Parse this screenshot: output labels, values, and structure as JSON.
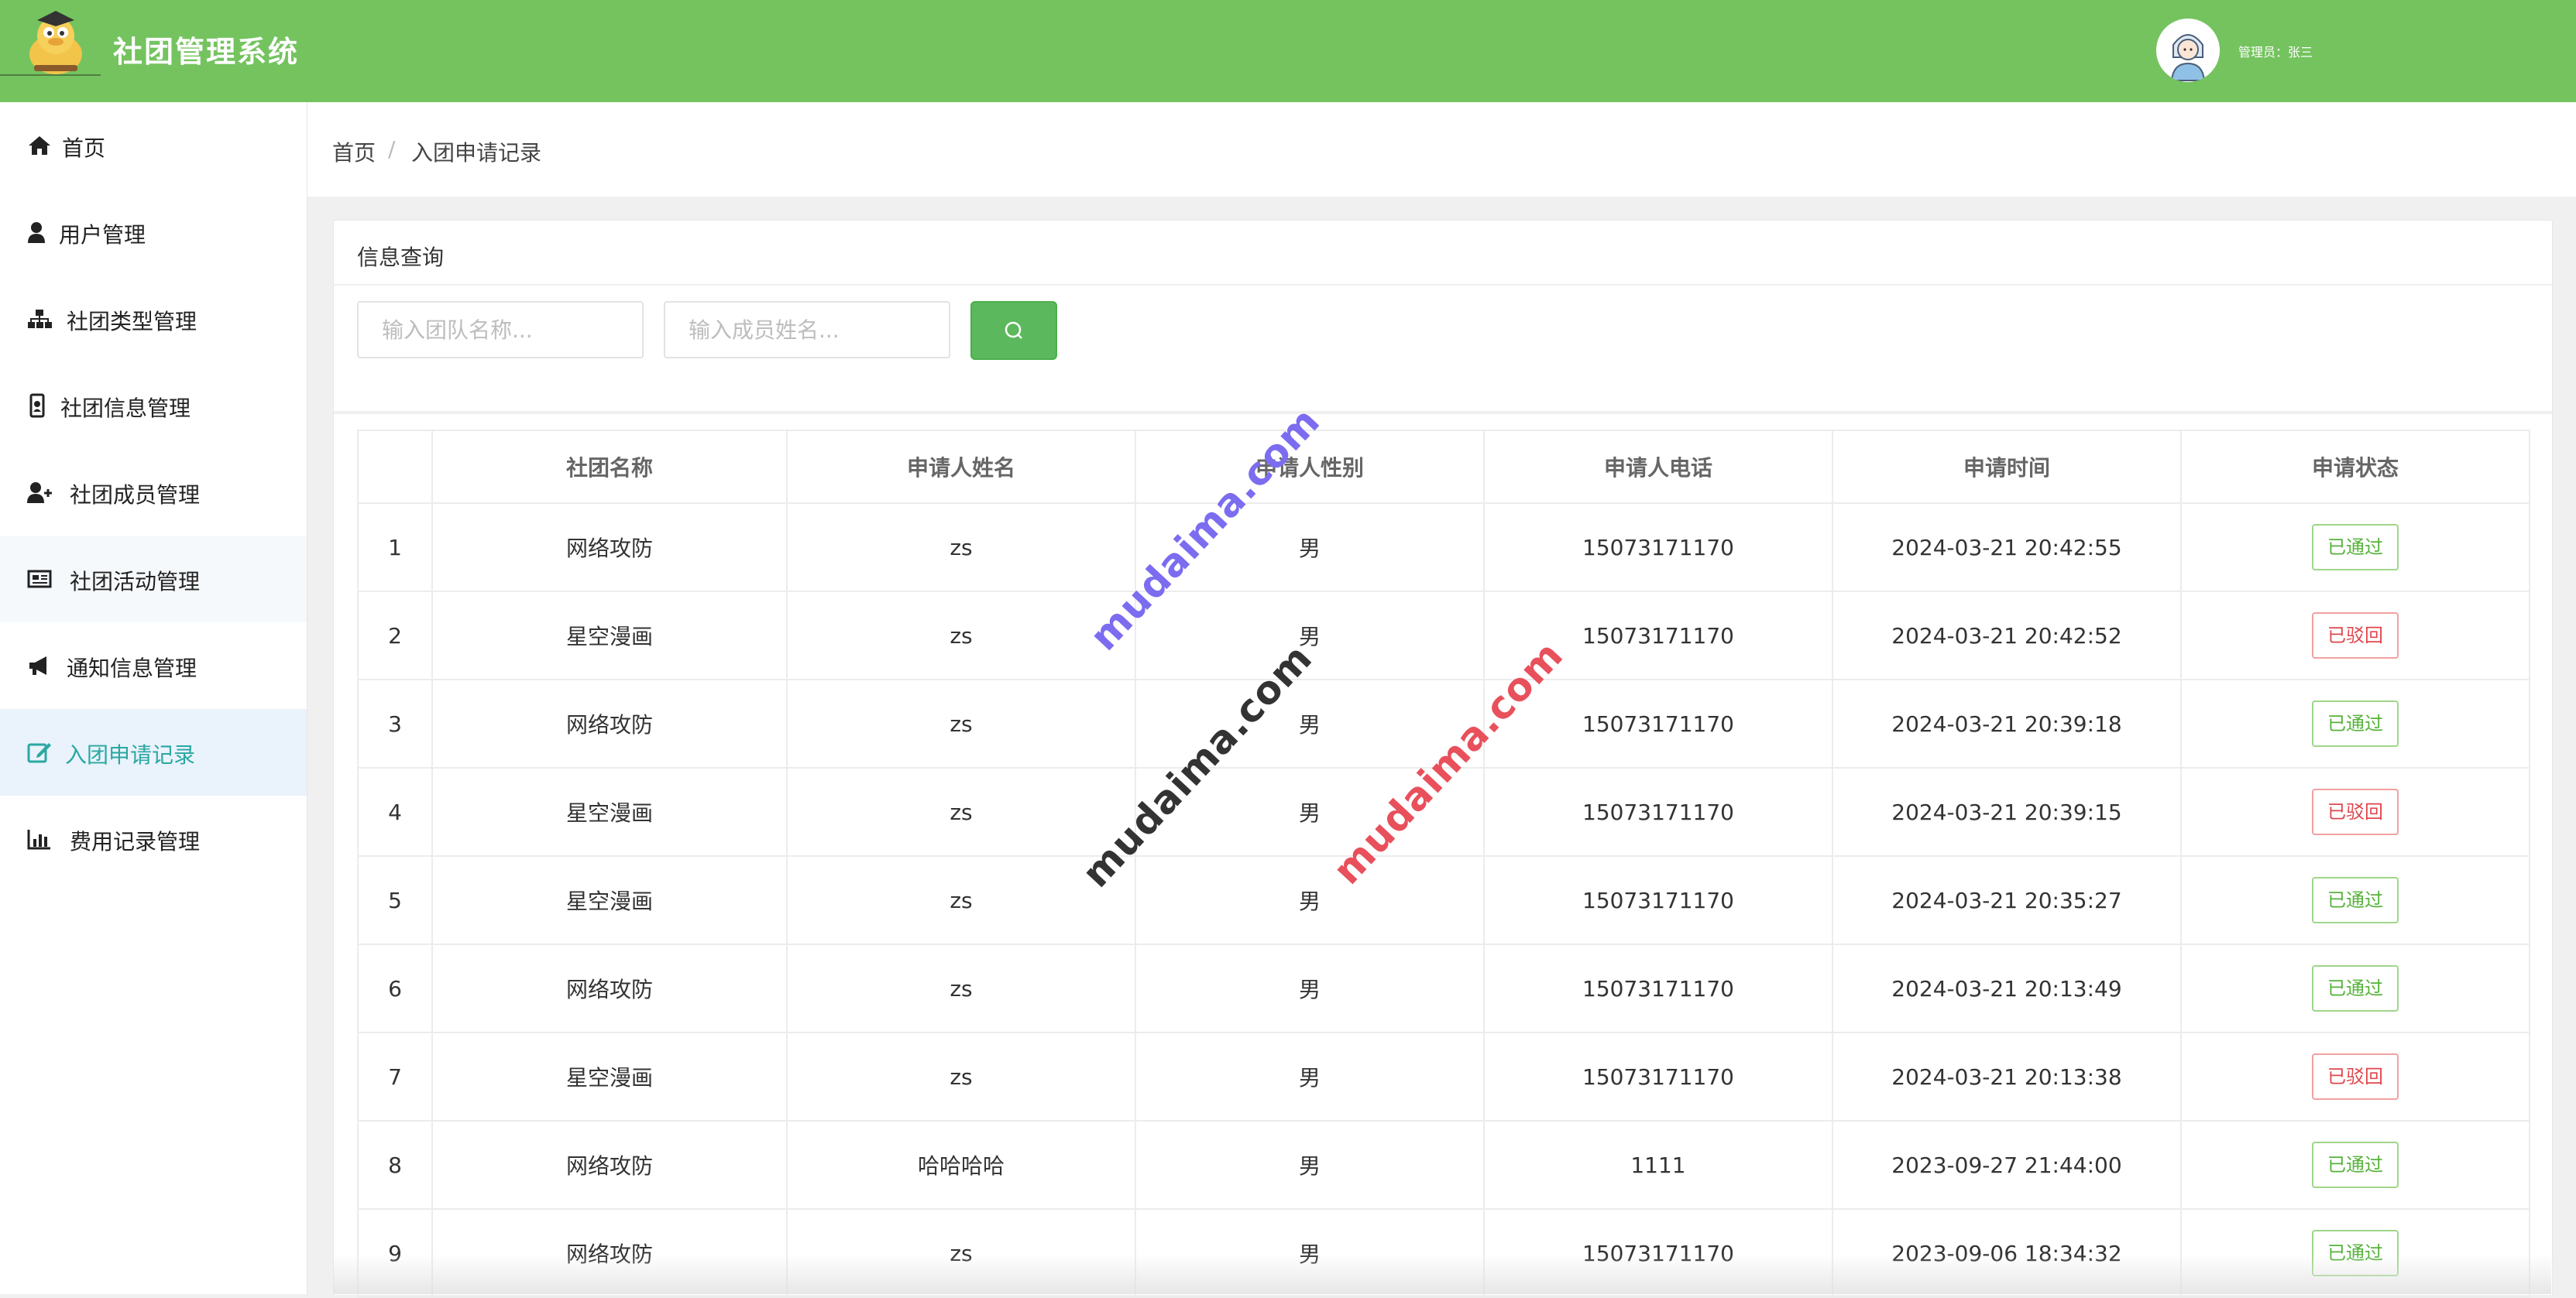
{
  "header": {
    "app_title": "社团管理系统",
    "admin_label": "管理员：张三"
  },
  "sidebar": {
    "items": [
      {
        "label": "首页",
        "icon": "home-icon"
      },
      {
        "label": "用户管理",
        "icon": "user-icon"
      },
      {
        "label": "社团类型管理",
        "icon": "sitemap-icon"
      },
      {
        "label": "社团信息管理",
        "icon": "id-badge-icon"
      },
      {
        "label": "社团成员管理",
        "icon": "user-plus-icon"
      },
      {
        "label": "社团活动管理",
        "icon": "newspaper-icon"
      },
      {
        "label": "通知信息管理",
        "icon": "bullhorn-icon"
      },
      {
        "label": "入团申请记录",
        "icon": "edit-icon",
        "active": true
      },
      {
        "label": "费用记录管理",
        "icon": "bar-chart-icon"
      }
    ]
  },
  "breadcrumb": {
    "home": "首页",
    "separator": "/",
    "current": "入团申请记录"
  },
  "search": {
    "title": "信息查询",
    "team_placeholder": "输入团队名称...",
    "member_placeholder": "输入成员姓名...",
    "button_icon": "search-icon"
  },
  "table": {
    "headers": [
      "",
      "社团名称",
      "申请人姓名",
      "申请人性别",
      "申请人电话",
      "申请时间",
      "申请状态"
    ],
    "rows": [
      {
        "index": "1",
        "club": "网络攻防",
        "name": "zs",
        "gender": "男",
        "phone": "15073171170",
        "time": "2024-03-21 20:42:55",
        "status": "已通过"
      },
      {
        "index": "2",
        "club": "星空漫画",
        "name": "zs",
        "gender": "男",
        "phone": "15073171170",
        "time": "2024-03-21 20:42:52",
        "status": "已驳回"
      },
      {
        "index": "3",
        "club": "网络攻防",
        "name": "zs",
        "gender": "男",
        "phone": "15073171170",
        "time": "2024-03-21 20:39:18",
        "status": "已通过"
      },
      {
        "index": "4",
        "club": "星空漫画",
        "name": "zs",
        "gender": "男",
        "phone": "15073171170",
        "time": "2024-03-21 20:39:15",
        "status": "已驳回"
      },
      {
        "index": "5",
        "club": "星空漫画",
        "name": "zs",
        "gender": "男",
        "phone": "15073171170",
        "time": "2024-03-21 20:35:27",
        "status": "已通过"
      },
      {
        "index": "6",
        "club": "网络攻防",
        "name": "zs",
        "gender": "男",
        "phone": "15073171170",
        "time": "2024-03-21 20:13:49",
        "status": "已通过"
      },
      {
        "index": "7",
        "club": "星空漫画",
        "name": "zs",
        "gender": "男",
        "phone": "15073171170",
        "time": "2024-03-21 20:13:38",
        "status": "已驳回"
      },
      {
        "index": "8",
        "club": "网络攻防",
        "name": "哈哈哈哈",
        "gender": "男",
        "phone": "1111",
        "time": "2023-09-27 21:44:00",
        "status": "已通过"
      },
      {
        "index": "9",
        "club": "网络攻防",
        "name": "zs",
        "gender": "男",
        "phone": "15073171170",
        "time": "2023-09-06 18:34:32",
        "status": "已通过"
      }
    ]
  },
  "watermarks": [
    {
      "text": "mudaima.com",
      "color": "#7b6cf0"
    },
    {
      "text": "mudaima.com",
      "color": "#333333"
    },
    {
      "text": "mudaima.com",
      "color": "#e8505b"
    }
  ],
  "colors": {
    "header_bg": "#74c35f",
    "active_text": "#2aa8a2",
    "pass": "#55b33a",
    "reject": "#e0474c",
    "search_button": "#5cb85c"
  }
}
